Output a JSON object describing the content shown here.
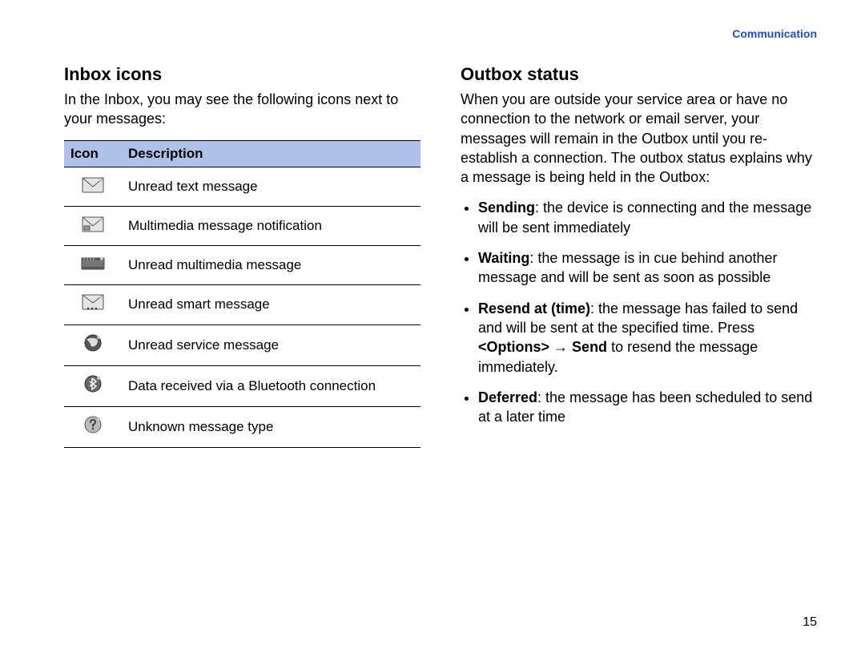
{
  "header": {
    "section_link": "Communication"
  },
  "left": {
    "heading": "Inbox icons",
    "intro": "In the Inbox, you may see the following icons next to your messages:",
    "table": {
      "head_icon": "Icon",
      "head_desc": "Description",
      "rows": [
        {
          "icon": "envelope-icon",
          "desc": "Unread text message"
        },
        {
          "icon": "mms-envelope-icon",
          "desc": "Multimedia message notification"
        },
        {
          "icon": "film-strip-icon",
          "desc": "Unread multimedia message"
        },
        {
          "icon": "smart-envelope-icon",
          "desc": "Unread smart message"
        },
        {
          "icon": "globe-icon",
          "desc": "Unread service message"
        },
        {
          "icon": "bluetooth-icon",
          "desc": "Data received via a Bluetooth connection"
        },
        {
          "icon": "question-circle-icon",
          "desc": "Unknown message type"
        }
      ]
    }
  },
  "right": {
    "heading": "Outbox status",
    "intro": "When you are outside your service area or have no connection to the network or email server, your messages will remain in the Outbox until you re-establish a connection. The outbox status explains why a message is being held in the Outbox:",
    "items": [
      {
        "label": "Sending",
        "text": ": the device is connecting and the message will be sent immediately"
      },
      {
        "label": "Waiting",
        "text": ": the message is in cue behind another message and will be sent as soon as possible"
      },
      {
        "label": "Resend at (time)",
        "prefix": ": the message has failed to send and will be sent at the specified time. Press ",
        "opt_left": "<",
        "opt_name": "Options",
        "opt_right": ">",
        "arrow": " → ",
        "opt_send": "Send",
        "suffix": " to resend the message immediately."
      },
      {
        "label": "Deferred",
        "text": ": the message has been scheduled to send at a later time"
      }
    ]
  },
  "page_number": "15"
}
